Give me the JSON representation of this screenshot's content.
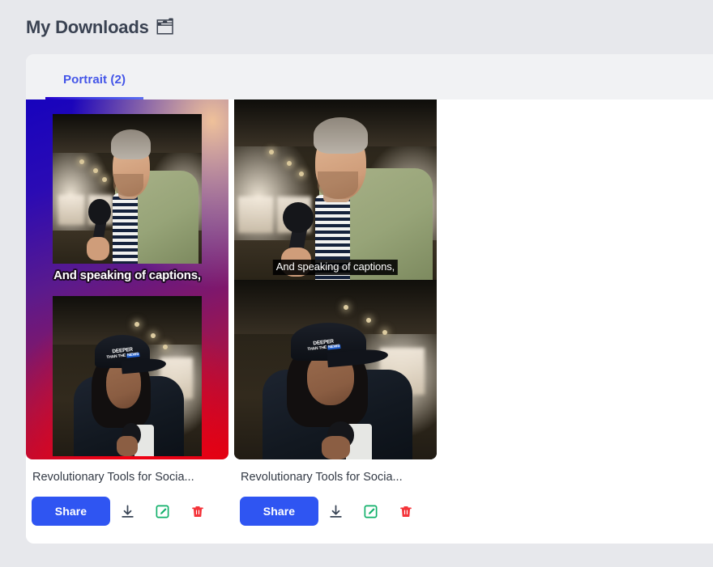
{
  "header": {
    "title": "My Downloads",
    "title_emoji": "🗂",
    "emoji_name": "folder-icon"
  },
  "tabs": [
    {
      "label": "Portrait (2)",
      "name": "tab-portrait",
      "active": true,
      "count": 2
    }
  ],
  "colors": {
    "page_bg": "#e7e8ec",
    "panel_bg": "#ffffff",
    "tabstrip_bg": "#f1f2f4",
    "tab_active_text": "#4355e8",
    "tab_underline_from": "#2200cc",
    "tab_underline_to": "#5b6ef0",
    "share_button": "#2f55f2",
    "download_icon": "#384455",
    "edit_icon": "#11b06a",
    "delete_icon": "#f4343a",
    "title_text": "#3a4252",
    "card_title_text": "#333a45"
  },
  "cards": [
    {
      "id": "card-1",
      "title": "Revolutionary Tools for Socia...",
      "style": "gradient-frame",
      "caption": "And speaking of captions,",
      "caption_style": "outlined-two-line",
      "gradient": {
        "top_left": "#1703bd",
        "top_right": "#efc19a",
        "bottom": "#e00010"
      },
      "cap_logo": {
        "line1": "DEEPER",
        "line2": "THAN THE",
        "line3": "NEWS"
      },
      "actions": {
        "share_label": "Share",
        "download_label": "Download",
        "edit_label": "Edit",
        "delete_label": "Delete"
      }
    },
    {
      "id": "card-2",
      "title": "Revolutionary Tools for Socia...",
      "style": "full-bleed",
      "caption": "And speaking of captions,",
      "caption_style": "black-band-one-line",
      "cap_logo": {
        "line1": "DEEPER",
        "line2": "THAN THE",
        "line3": "NEWS"
      },
      "actions": {
        "share_label": "Share",
        "download_label": "Download",
        "edit_label": "Edit",
        "delete_label": "Delete"
      }
    }
  ]
}
